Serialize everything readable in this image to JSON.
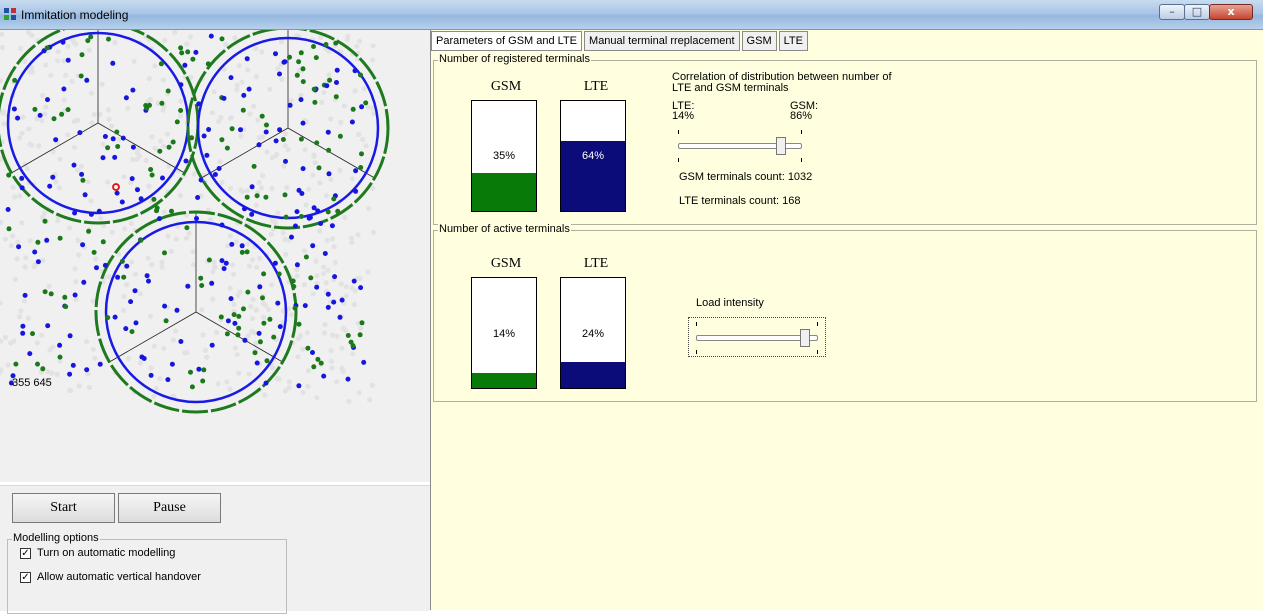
{
  "window": {
    "title": "Immitation modeling",
    "minimize": "–",
    "maximize": "□",
    "close": "x"
  },
  "simulation": {
    "coordinates": "355 645"
  },
  "controls": {
    "start_label": "Start",
    "pause_label": "Pause",
    "options_title": "Modelling options",
    "options": [
      {
        "label": "Turn on automatic modelling",
        "checked": true
      },
      {
        "label": "Allow automatic vertical handover",
        "checked": true
      }
    ]
  },
  "tabs": [
    {
      "label": "Parameters of GSM and LTE",
      "active": true
    },
    {
      "label": "Manual terminal rreplacement",
      "active": false
    },
    {
      "label": "GSM",
      "active": false
    },
    {
      "label": "LTE",
      "active": false
    }
  ],
  "registered": {
    "title": "Number of registered terminals",
    "gsm": {
      "label": "GSM",
      "percent_text": "35%",
      "fraction": 0.35
    },
    "lte": {
      "label": "LTE",
      "percent_text": "64%",
      "fraction": 0.64
    },
    "correlation_title": "Correlation of distribution between number of LTE and GSM terminals",
    "lte_label": "LTE:",
    "lte_value": "14%",
    "gsm_label": "GSM:",
    "gsm_value": "86%",
    "slider_fraction": 0.86,
    "gsm_count": "GSM terminals count: 1032",
    "lte_count": "LTE terminals count: 168"
  },
  "active": {
    "title": "Number of active terminals",
    "gsm": {
      "label": "GSM",
      "percent_text": "14%",
      "fraction": 0.14
    },
    "lte": {
      "label": "LTE",
      "percent_text": "24%",
      "fraction": 0.24
    },
    "load_label": "Load intensity",
    "slider_fraction": 0.93
  },
  "colors": {
    "gsm": "#087a08",
    "lte": "#0b0b7a",
    "gsm_dot": "#1a7a1a",
    "lte_dot": "#1616e0",
    "cell_green": "#1f7a1f",
    "cell_blue": "#1a1ae6"
  }
}
